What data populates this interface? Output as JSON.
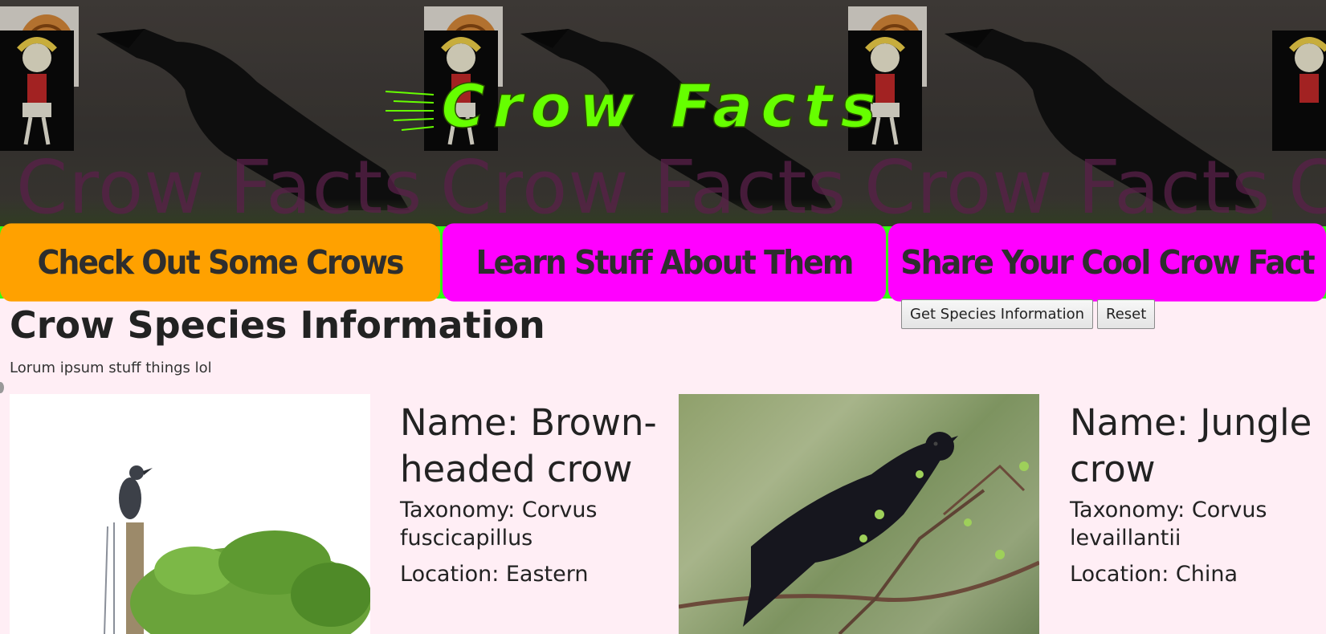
{
  "banner": {
    "title": "Crow Facts",
    "watermark": "Crow Facts",
    "title_color": "#66ff00"
  },
  "nav": {
    "items": [
      {
        "label": "Check Out Some Crows",
        "color": "#ffa100"
      },
      {
        "label": "Learn Stuff About Them",
        "color": "#ff00ff"
      },
      {
        "label": "Share Your Cool Crow Fact",
        "color": "#ff00ff"
      }
    ],
    "background": "#33ff11"
  },
  "main": {
    "title": "Crow Species Information",
    "subtitle": "Lorum ipsum stuff things lol",
    "buttons": {
      "get_info": "Get Species Information",
      "reset": "Reset"
    }
  },
  "species": [
    {
      "name": "Name: Brown-headed crow",
      "taxonomy": "Taxonomy: Corvus fuscicapillus",
      "location": "Location: Eastern"
    },
    {
      "name": "Name: Jungle crow",
      "taxonomy": "Taxonomy: Corvus levaillantii",
      "location": "Location: China"
    }
  ]
}
